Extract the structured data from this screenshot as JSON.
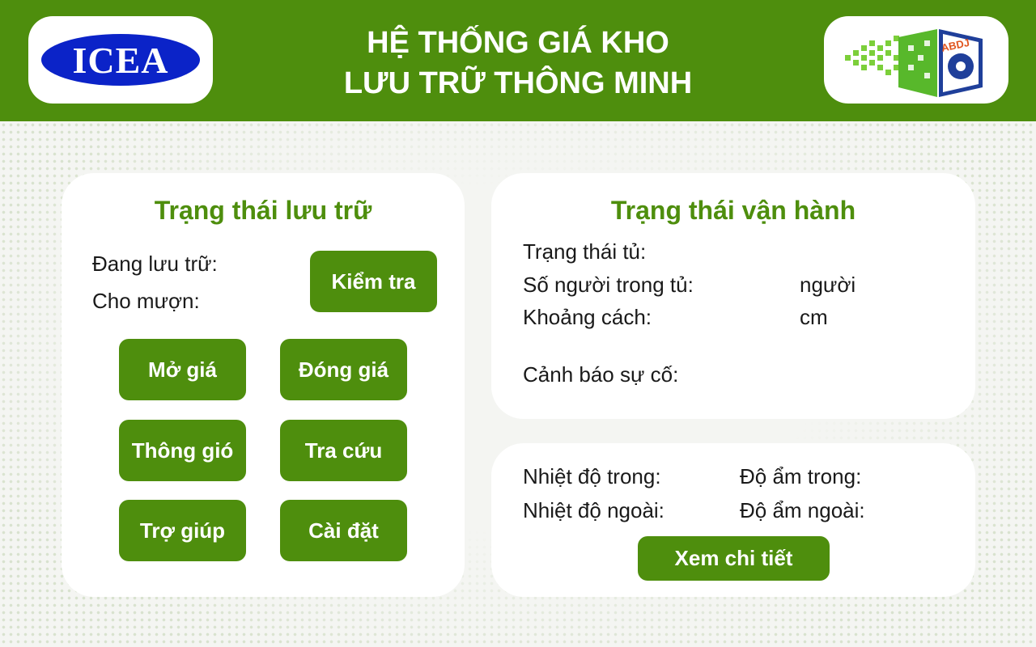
{
  "header": {
    "title_line1": "HỆ THỐNG GIÁ KHO",
    "title_line2": "LƯU TRỮ THÔNG MINH",
    "logo_left_text": "ICEA",
    "logo_right_text": "ABDJ",
    "colors": {
      "brand_green": "#4e8e0d",
      "logo_blue": "#0b23c8",
      "logo_right_accent": "#e0551f"
    }
  },
  "storage": {
    "title": "Trạng thái lưu trữ",
    "storing_label": "Đang lưu trữ:",
    "lending_label": "Cho mượn:",
    "check_button": "Kiểm tra",
    "buttons": {
      "open_shelf": "Mở giá",
      "close_shelf": "Đóng giá",
      "ventilation": "Thông gió",
      "lookup": "Tra cứu",
      "help": "Trợ giúp",
      "settings": "Cài đặt"
    }
  },
  "operation": {
    "title": "Trạng thái vận hành",
    "cabinet_status_label": "Trạng thái tủ:",
    "people_label": "Số người trong tủ:",
    "people_unit": "người",
    "distance_label": "Khoảng cách:",
    "distance_unit": "cm",
    "incident_label": "Cảnh báo sự cố:"
  },
  "environment": {
    "temp_in_label": "Nhiệt độ trong:",
    "temp_out_label": "Nhiệt độ ngoài:",
    "humidity_in_label": "Độ ẩm trong:",
    "humidity_out_label": "Độ ẩm ngoài:",
    "details_button": "Xem chi tiết"
  }
}
